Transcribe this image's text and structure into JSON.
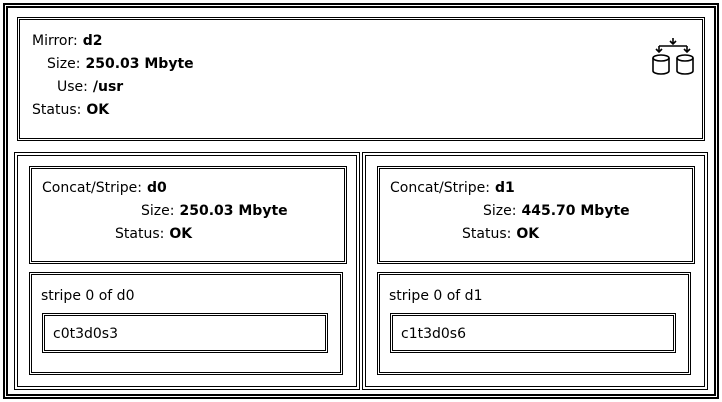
{
  "mirror": {
    "mirror_label": "Mirror:",
    "mirror_value": "d2",
    "size_label": "Size:",
    "size_value": "250.03 Mbyte",
    "use_label": "Use:",
    "use_value": "/usr",
    "status_label": "Status:",
    "status_value": "OK",
    "icon": "mirror-disks-icon"
  },
  "left": {
    "type_label": "Concat/Stripe:",
    "type_value": "d0",
    "size_label": "Size:",
    "size_value": "250.03 Mbyte",
    "status_label": "Status:",
    "status_value": "OK",
    "stripe_label": "stripe 0 of d0",
    "slice": "c0t3d0s3"
  },
  "right": {
    "type_label": "Concat/Stripe:",
    "type_value": "d1",
    "size_label": "Size:",
    "size_value": "445.70 Mbyte",
    "status_label": "Status:",
    "status_value": "OK",
    "stripe_label": "stripe 0 of d1",
    "slice": "c1t3d0s6"
  }
}
